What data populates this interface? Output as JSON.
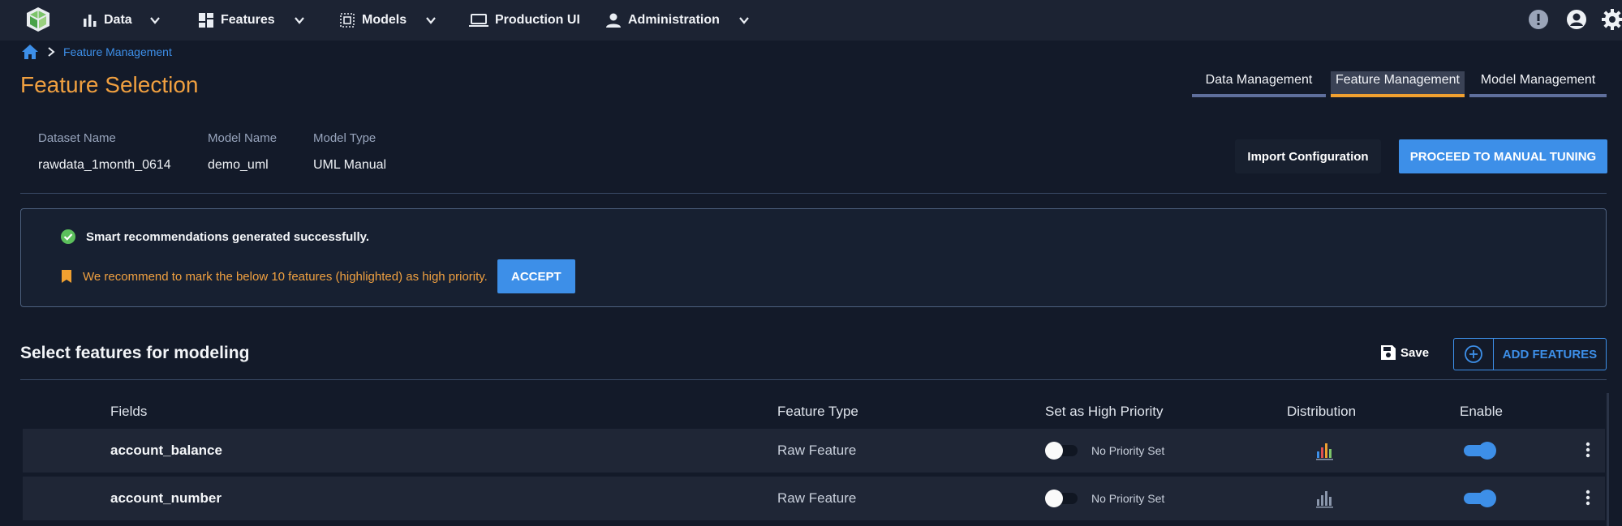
{
  "nav": {
    "items": [
      {
        "label": "Data",
        "icon": "bar-chart-icon"
      },
      {
        "label": "Features",
        "icon": "dashboard-icon"
      },
      {
        "label": "Models",
        "icon": "model-grid-icon"
      },
      {
        "label": "Production UI",
        "icon": "laptop-icon"
      },
      {
        "label": "Administration",
        "icon": "person-icon"
      }
    ]
  },
  "breadcrumb": {
    "current": "Feature Management"
  },
  "page": {
    "title": "Feature Selection"
  },
  "tabs": [
    {
      "label": "Data Management",
      "active": false
    },
    {
      "label": "Feature Management",
      "active": true
    },
    {
      "label": "Model Management",
      "active": false
    }
  ],
  "meta": [
    {
      "label": "Dataset Name",
      "value": "rawdata_1month_0614"
    },
    {
      "label": "Model Name",
      "value": "demo_uml"
    },
    {
      "label": "Model Type",
      "value": "UML Manual"
    }
  ],
  "actions": {
    "import_label": "Import Configuration",
    "proceed_label": "PROCEED TO MANUAL TUNING"
  },
  "notice": {
    "success_text": "Smart recommendations generated successfully.",
    "recommend_text": "We recommend to mark the below 10 features (highlighted) as high priority.",
    "accept_label": "ACCEPT"
  },
  "section": {
    "title": "Select features for modeling",
    "save_label": "Save",
    "add_label": "ADD FEATURES"
  },
  "table": {
    "headers": [
      "Fields",
      "Feature Type",
      "Set as High Priority",
      "Distribution",
      "Enable"
    ],
    "rows": [
      {
        "field": "account_balance",
        "type": "Raw Feature",
        "priority": "No Priority Set",
        "enabled": true
      },
      {
        "field": "account_number",
        "type": "Raw Feature",
        "priority": "No Priority Set",
        "enabled": true
      }
    ]
  },
  "colors": {
    "accent": "#3d8fe8",
    "title": "#f0a040",
    "background": "#131a29",
    "topbar": "#1c2333"
  }
}
